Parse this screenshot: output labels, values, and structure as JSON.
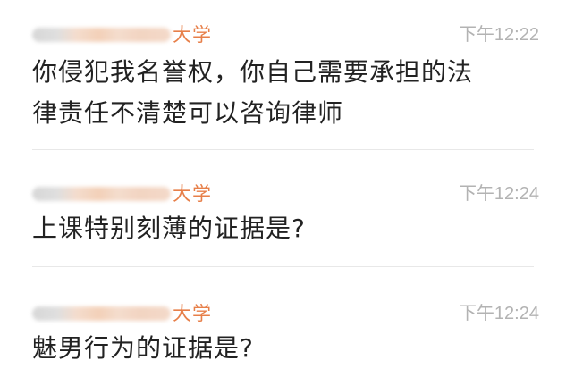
{
  "comments": [
    {
      "author_suffix": "大学",
      "timestamp": "下午12:22",
      "text": "你侵犯我名誉权，你自己需要承担的法\n律责任不清楚可以咨询律师"
    },
    {
      "author_suffix": "大学",
      "timestamp": "下午12:24",
      "text": "上课特别刻薄的证据是?"
    },
    {
      "author_suffix": "大学",
      "timestamp": "下午12:24",
      "text": "魅男行为的证据是?"
    }
  ],
  "colors": {
    "author_accent": "#e77f49",
    "timestamp": "#b3b3b3",
    "body_text": "#222222",
    "divider": "#e8e8e8"
  }
}
